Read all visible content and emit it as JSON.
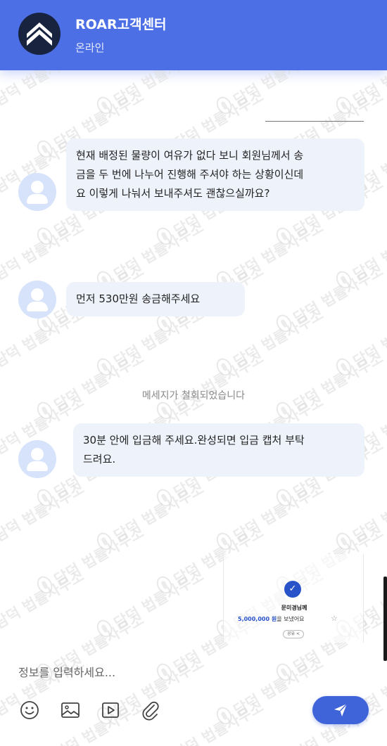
{
  "header": {
    "title": "ROAR고객센터",
    "status": "온라인"
  },
  "watermark": {
    "text": "담덕 법률사무소"
  },
  "messages": [
    {
      "text": "현재 배정된 물량이 여유가 없다 보니 회원님께서 송\n금을 두 번에 나누어 진행해 주셔야 하는 상황이신데\n요 이렇게 나눠서 보내주셔도 괜찮으실까요?"
    },
    {
      "text": "먼저 530만원 송금해주세요"
    },
    {
      "text": "30분 안에 입금해 주세요.완성되면 입금 캡처 부탁\n드려요."
    }
  ],
  "system_notice": "메세지가 철회되었습니다",
  "receipt": {
    "recipient": "문미경님께",
    "amount": "5,000,000 원",
    "amount_suffix": "을 보냈어요",
    "share_label": "공유 <"
  },
  "composer": {
    "placeholder": "정보를 입력하세요..."
  },
  "toolbar": {
    "icons": [
      "emoji-icon",
      "image-icon",
      "video-icon",
      "attachment-icon"
    ]
  },
  "colors": {
    "header": "#4d6fe6",
    "bubble": "#eef2fb",
    "send": "#3f63d8",
    "avatar": "#d6e3fb"
  }
}
